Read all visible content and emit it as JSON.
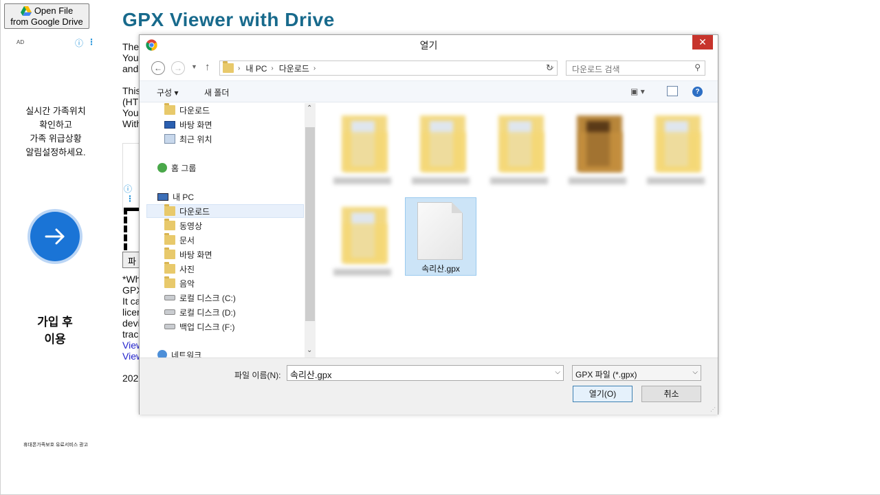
{
  "sidebar": {
    "drive_button_line1": "Open File",
    "drive_button_line2": "from Google Drive",
    "ad_label": "AD",
    "ad_text_lines": [
      "실시간 가족위치",
      "확인하고",
      "가족 위급상황",
      "알림설정하세요."
    ],
    "join_line1": "가입 후",
    "join_line2": "이용",
    "footer": "휴대폰가족보호 유료서비스 광고"
  },
  "page": {
    "title": "GPX Viewer with Drive",
    "bg_fragments": [
      "The",
      "You",
      "and",
      "This",
      "(HT",
      "You",
      "With",
      "파",
      "*Wh",
      "GPX",
      "It ca",
      "licer",
      "devi",
      "trac",
      "View",
      "View",
      "202"
    ]
  },
  "dialog": {
    "title": "열기",
    "close_label": "✕",
    "address": {
      "root": "내 PC",
      "current": "다운로드"
    },
    "search_placeholder": "다운로드 검색",
    "toolbar": {
      "organize": "구성",
      "new_folder": "새 폴더"
    },
    "nav_items": [
      {
        "label": "다운로드",
        "icon": "downloads-folder-icon"
      },
      {
        "label": "바탕 화면",
        "icon": "desktop-icon"
      },
      {
        "label": "최근 위치",
        "icon": "recent-places-icon"
      },
      {
        "label": "홈 그룹",
        "icon": "homegroup-icon"
      },
      {
        "label": "내 PC",
        "icon": "this-pc-icon"
      },
      {
        "label": "다운로드",
        "icon": "downloads-folder-icon",
        "selected": true
      },
      {
        "label": "동영상",
        "icon": "videos-folder-icon"
      },
      {
        "label": "문서",
        "icon": "documents-folder-icon"
      },
      {
        "label": "바탕 화면",
        "icon": "desktop-folder-icon"
      },
      {
        "label": "사진",
        "icon": "pictures-folder-icon"
      },
      {
        "label": "음악",
        "icon": "music-folder-icon"
      },
      {
        "label": "로컬 디스크 (C:)",
        "icon": "windows-drive-icon"
      },
      {
        "label": "로컬 디스크 (D:)",
        "icon": "drive-icon"
      },
      {
        "label": "백업 디스크 (F:)",
        "icon": "drive-icon"
      },
      {
        "label": "네트워크",
        "icon": "network-icon"
      }
    ],
    "files": [
      {
        "name": "",
        "blurred": true
      },
      {
        "name": "",
        "blurred": true
      },
      {
        "name": "",
        "blurred": true
      },
      {
        "name": "",
        "blurred": true
      },
      {
        "name": "",
        "blurred": true
      },
      {
        "name": "",
        "blurred": true
      },
      {
        "name": "속리산.gpx",
        "blurred": false,
        "selected": true
      }
    ],
    "filename_label": "파일 이름(N):",
    "filename_value": "속리산.gpx",
    "filetype_value": "GPX 파일 (*.gpx)",
    "open_button": "열기(O)",
    "cancel_button": "취소"
  },
  "colors": {
    "title_blue": "#186a8c",
    "close_red": "#c7342c",
    "selection_blue": "#cce4f7",
    "ad_button_blue": "#1a74d6"
  }
}
